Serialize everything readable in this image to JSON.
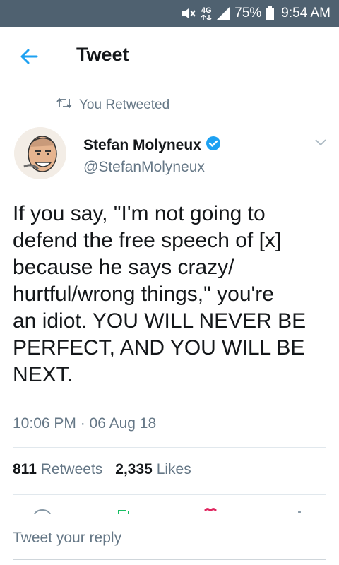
{
  "status_bar": {
    "network": "4G",
    "battery": "75%",
    "time": "9:54 AM"
  },
  "header": {
    "title": "Tweet"
  },
  "retweet_context": {
    "label": "You Retweeted"
  },
  "author": {
    "name": "Stefan Molyneux",
    "handle": "@StefanMolyneux",
    "verified": true
  },
  "tweet": {
    "lines": [
      "If you say, \"I'm not going to",
      "defend the free speech of [x]",
      "because he says crazy/",
      "hurtful/wrong things,\" you're",
      "an idiot. YOU WILL NEVER BE",
      "PERFECT, AND YOU WILL BE",
      "NEXT."
    ],
    "timestamp": "10:06 PM · 06 Aug 18"
  },
  "stats": {
    "retweets_count": "811",
    "retweets_label": "Retweets",
    "likes_count": "2,335",
    "likes_label": "Likes"
  },
  "reply": {
    "placeholder": "Tweet your reply"
  },
  "colors": {
    "status_bar": "#4f6170",
    "accent_blue": "#1da1f2",
    "like_red": "#e0245e",
    "retweet_green": "#17bf63"
  }
}
